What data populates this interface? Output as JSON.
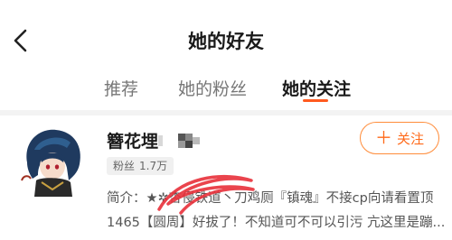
{
  "header": {
    "title": "她的好友",
    "back_icon": "chevron-left-icon"
  },
  "tabs": [
    {
      "label": "推荐",
      "active": false
    },
    {
      "label": "她的粉丝",
      "active": false
    },
    {
      "label": "她的关注",
      "active": true
    }
  ],
  "accent_color": "#ff5a1f",
  "user": {
    "name": "簪花埋",
    "fans_label": "粉丝",
    "fans_count": "1.7万",
    "follow_label": "关注",
    "bio_line1": "简介：★✲杏侵铁道丶刀鸡厕『镇魂』不接cp向请看置顶",
    "bio_line2": "1465【圆周】好拔了！不知道可不可以引污 亢这里是蹦..."
  }
}
